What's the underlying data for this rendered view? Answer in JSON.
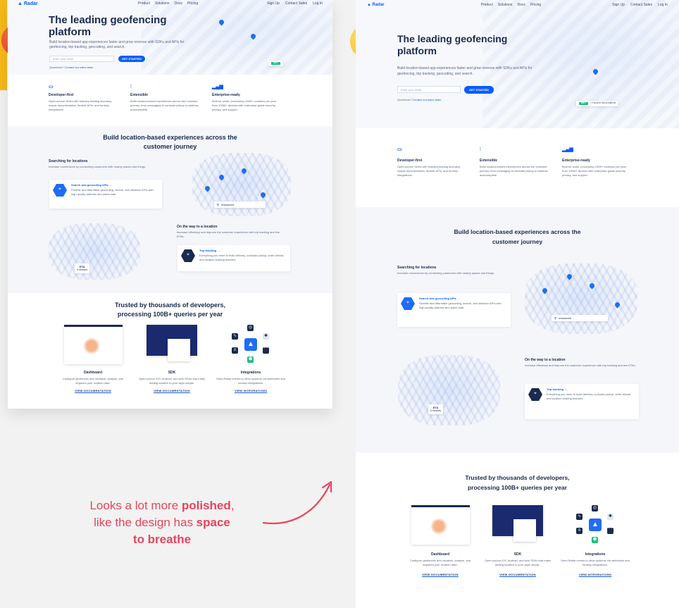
{
  "nav": {
    "logo": "Radar",
    "links": [
      "Product",
      "Solutions",
      "Docs",
      "Pricing"
    ],
    "right": [
      "Sign Up",
      "Contact Sales",
      "Log In"
    ]
  },
  "hero": {
    "title": "The leading geofencing platform",
    "subtitle": "Build location-based app experiences faster and grow revenue with SDKs and APIs for geofencing, trip tracking, geocoding, and search.",
    "email_placeholder": "Enter your email",
    "cta": "GET STARTED",
    "questions": "Questions?",
    "questions_link": "Contact our sales team",
    "api_verb": "GET",
    "api_path": "/route/distance"
  },
  "features": [
    {
      "icon": "terminal-icon",
      "title": "Developer-first",
      "desc": "Open-source SDKs with industry-leading accuracy, simple documentation, flexible APIs, and turnkey integrations."
    },
    {
      "icon": "sliders-icon",
      "title": "Extensible",
      "desc": "Build location-based experiences across the customer journey, from messaging to curbside pickup to address autocomplete."
    },
    {
      "icon": "bar-chart-icon",
      "title": "Enterprise-ready",
      "desc": "Built for scale, processing 100B+ locations per year from 100M+ devices with enterprise-grade security, privacy, and support."
    }
  ],
  "journey": {
    "title": "Build location-based experiences across the customer journey",
    "search": {
      "title": "Searching for locations",
      "desc": "Increase conversions by connecting customers with nearby places and things.",
      "card_title": "Search and geocoding APIs →",
      "card_desc": "Flexible and affordable geocoding, search, and distance APIs with high-quality address and place data.",
      "search_text": "restaurant"
    },
    "way": {
      "title": "On the way to a location",
      "desc": "Increase efficiency and improve the customer experience with trip tracking and live ETAs.",
      "card_title": "Trip tracking →",
      "card_desc": "Everything you need to build delivery, curbside pickup, order-ahead, and location sharing features.",
      "eta_label": "ETA",
      "eta_value": "6 minutes"
    }
  },
  "trusted": {
    "title": "Trusted by thousands of developers, processing 100B+ queries per year",
    "columns": [
      {
        "title": "Dashboard",
        "desc": "Configure geofences and visualize, analyze, and segment your location data.",
        "link": "VIEW DOCUMENTATION"
      },
      {
        "title": "SDK",
        "desc": "Open-source iOS, Android, and web SDKs that make adding location to your apps simple.",
        "link": "VIEW DOCUMENTATION"
      },
      {
        "title": "Integrations",
        "desc": "Send Radar events to other systems via webhooks and turnkey integrations.",
        "link": "VIEW INTEGRATIONS"
      }
    ]
  },
  "caption": {
    "line1_pre": "Looks a lot more ",
    "line1_bold": "polished",
    "line1_post": ",",
    "line2_pre": "like the design has ",
    "line2_bold": "space",
    "line3_bold": "to breathe"
  },
  "colors": {
    "accent": "#0a5cff",
    "navy": "#1b2a4e",
    "caption": "#e8445e",
    "side_bar": "#f6b91a"
  }
}
